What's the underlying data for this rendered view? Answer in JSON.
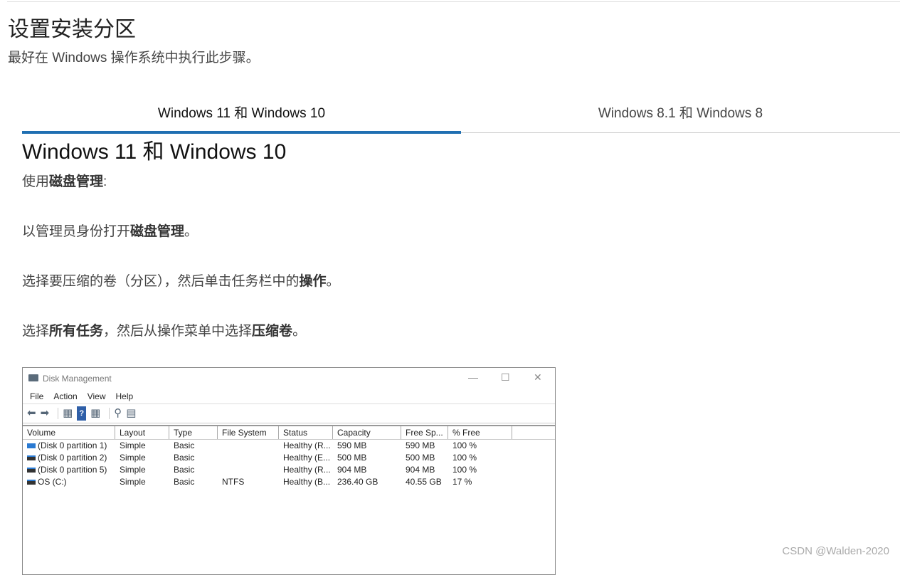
{
  "page": {
    "title": "设置安装分区",
    "subtitle": "最好在 Windows 操作系统中执行此步骤。"
  },
  "tabs": [
    {
      "label": "Windows 11 和 Windows 10",
      "active": true
    },
    {
      "label": "Windows 8.1 和 Windows 8",
      "active": false
    }
  ],
  "section": {
    "title": "Windows 11 和 Windows 10",
    "steps": [
      {
        "pre": "使用",
        "bold": "磁盘管理",
        "post": ":",
        "bold2": "",
        "post2": ""
      },
      {
        "pre": "以管理员身份打开",
        "bold": "磁盘管理",
        "post": "。",
        "bold2": "",
        "post2": ""
      },
      {
        "pre": "选择要压缩的卷（分区），然后单击任务栏中的",
        "bold": "操作",
        "post": "。",
        "bold2": "",
        "post2": ""
      },
      {
        "pre": "选择",
        "bold": "所有任务",
        "post": "，然后从操作菜单中选择",
        "bold2": "压缩卷",
        "post2": "。"
      }
    ]
  },
  "disk_management": {
    "title": "Disk Management",
    "controls": {
      "minimize": "—",
      "maximize": "☐",
      "close": "✕"
    },
    "menu": [
      "File",
      "Action",
      "View",
      "Help"
    ],
    "toolbar_icons": [
      "back-arrow-icon",
      "forward-arrow-icon",
      "properties-icon",
      "help-icon",
      "refresh-icon",
      "rescan-icon",
      "settings-icon"
    ],
    "toolbar_glyphs": [
      "⬅",
      "➡",
      "▦",
      "?",
      "▦",
      "⚲",
      "▤"
    ],
    "columns": [
      "Volume",
      "Layout",
      "Type",
      "File System",
      "Status",
      "Capacity",
      "Free Sp...",
      "% Free"
    ],
    "rows": [
      {
        "volume": "(Disk 0 partition 1)",
        "layout": "Simple",
        "type": "Basic",
        "fs": "",
        "status": "Healthy (R...",
        "capacity": "590 MB",
        "free": "590 MB",
        "pct": "100 %"
      },
      {
        "volume": "(Disk 0 partition 2)",
        "layout": "Simple",
        "type": "Basic",
        "fs": "",
        "status": "Healthy (E...",
        "capacity": "500 MB",
        "free": "500 MB",
        "pct": "100 %"
      },
      {
        "volume": "(Disk 0 partition 5)",
        "layout": "Simple",
        "type": "Basic",
        "fs": "",
        "status": "Healthy (R...",
        "capacity": "904 MB",
        "free": "904 MB",
        "pct": "100 %"
      },
      {
        "volume": "OS (C:)",
        "layout": "Simple",
        "type": "Basic",
        "fs": "NTFS",
        "status": "Healthy (B...",
        "capacity": "236.40 GB",
        "free": "40.55 GB",
        "pct": "17 %"
      }
    ]
  },
  "watermark": "CSDN @Walden-2020",
  "colors": {
    "accent": "#1f6fb2",
    "text": "#333333"
  }
}
